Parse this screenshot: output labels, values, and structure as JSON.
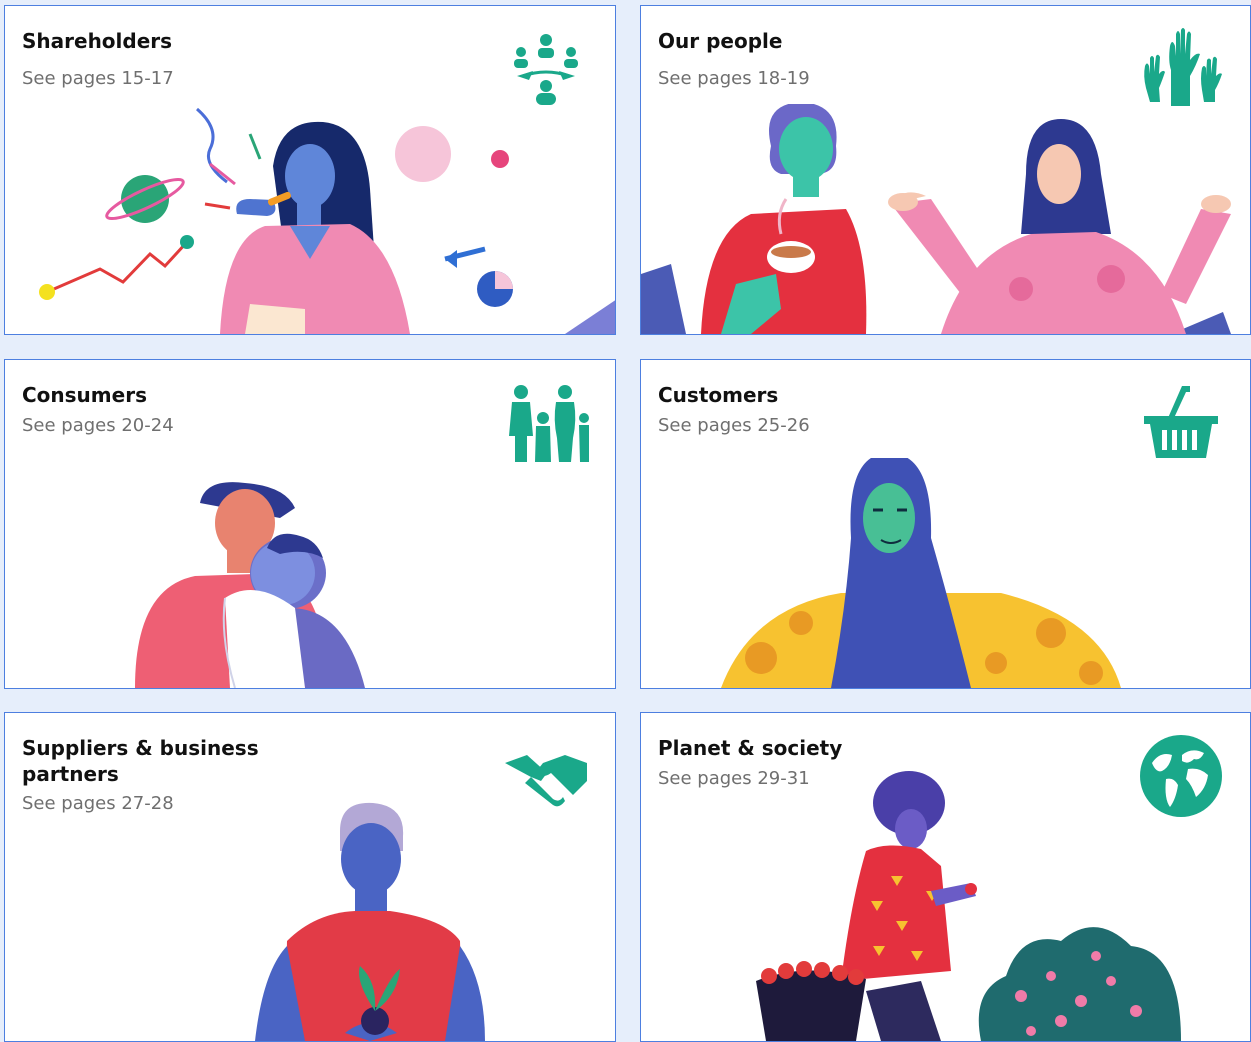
{
  "colors": {
    "accent": "#1aa88a",
    "border": "#4d7fe0",
    "background": "#e6eefb"
  },
  "cards": [
    {
      "title": "Shareholders",
      "pages": "See pages 15-17",
      "icon": "shareholders-group-icon"
    },
    {
      "title": "Our people",
      "pages": "See pages 18-19",
      "icon": "raised-hands-icon"
    },
    {
      "title": "Consumers",
      "pages": "See pages 20-24",
      "icon": "family-icon"
    },
    {
      "title": "Customers",
      "pages": "See pages 25-26",
      "icon": "shopping-basket-icon"
    },
    {
      "title": "Suppliers & business partners",
      "pages": "See pages 27-28",
      "icon": "handshake-icon"
    },
    {
      "title": "Planet & society",
      "pages": "See pages 29-31",
      "icon": "globe-icon"
    }
  ]
}
